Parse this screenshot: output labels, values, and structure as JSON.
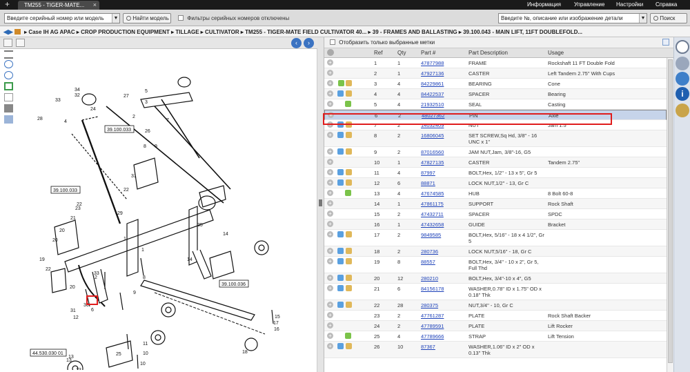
{
  "app": {
    "tab_title": "TM255 - TIGER-MATE...",
    "nav": [
      "Информация",
      "Управление",
      "Настройки",
      "Справка"
    ]
  },
  "toolbar": {
    "serial_select": "Введите серийный номер или модель",
    "find_model_button": "Найти модель",
    "serial_filter_label": "Фильтры серийных номеров отключены",
    "search_placeholder": "Введите №, описание или изображение детали",
    "search_value": "Введите №, описание или изображение детали",
    "search_button": "Поиск"
  },
  "breadcrumb": [
    "Case IH AG APAC",
    "CROP PRODUCTION EQUIPMENT",
    "TILLAGE",
    "CULTIVATOR",
    "TM255 - TIGER-MATE FIELD CULTIVATOR 40...",
    "39 - FRAMES AND BALLASTING",
    "39.100.043 - MAIN LIFT, 11FT DOUBLEFOLD..."
  ],
  "parts_panel": {
    "show_selected_label": "Отобразить только выбранные метки",
    "columns": [
      "Ref",
      "Qty",
      "Part #",
      "Part Description",
      "Usage"
    ],
    "selected_index": 5,
    "rows": [
      {
        "ref": "1",
        "qty": "1",
        "part": "47877988",
        "desc": "FRAME",
        "usage": "Rockshaft 11 FT Double Fold",
        "icons": ""
      },
      {
        "ref": "2",
        "qty": "1",
        "part": "47927136",
        "desc": "CASTER",
        "usage": "Left Tandem 2.75\" With Cups",
        "icons": ""
      },
      {
        "ref": "3",
        "qty": "4",
        "part": "84229861",
        "desc": "BEARING",
        "usage": "Cone",
        "icons": "gb"
      },
      {
        "ref": "4",
        "qty": "4",
        "part": "84422537",
        "desc": "SPACER",
        "usage": "Bearing",
        "icons": "ab"
      },
      {
        "ref": "5",
        "qty": "4",
        "part": "21932510",
        "desc": "SEAL",
        "usage": "Casting",
        "icons": "g"
      },
      {
        "ref": "6",
        "qty": "2",
        "part": "48027362",
        "desc": "PIN",
        "usage": "Axle",
        "icons": ""
      },
      {
        "ref": "7",
        "qty": "2",
        "part": "14032409",
        "desc": "NUT",
        "usage": "Jam 1.5\"",
        "icons": "ab"
      },
      {
        "ref": "8",
        "qty": "2",
        "part": "16806045",
        "desc": "SET SCREW,Sq Hd, 3/8\" - 16 UNC x 1\"",
        "usage": "",
        "icons": "ab"
      },
      {
        "ref": "9",
        "qty": "2",
        "part": "87016560",
        "desc": "JAM NUT,Jam, 3/8\"-16, G5",
        "usage": "",
        "icons": "ab"
      },
      {
        "ref": "10",
        "qty": "1",
        "part": "47827135",
        "desc": "CASTER",
        "usage": "Tandem 2.75\"",
        "icons": ""
      },
      {
        "ref": "11",
        "qty": "4",
        "part": "87997",
        "desc": "BOLT,Hex, 1/2\" - 13 x 5\", Gr 5",
        "usage": "",
        "icons": "ab"
      },
      {
        "ref": "12",
        "qty": "6",
        "part": "88871",
        "desc": "LOCK NUT,1/2\" - 13, Gr C",
        "usage": "",
        "icons": "ab"
      },
      {
        "ref": "13",
        "qty": "4",
        "part": "47674585",
        "desc": "HUB",
        "usage": "8 Bolt 60-8",
        "icons": "g"
      },
      {
        "ref": "14",
        "qty": "1",
        "part": "47861175",
        "desc": "SUPPORT",
        "usage": "Rock Shaft",
        "icons": ""
      },
      {
        "ref": "15",
        "qty": "2",
        "part": "47432711",
        "desc": "SPACER",
        "usage": "SPDC",
        "icons": ""
      },
      {
        "ref": "16",
        "qty": "1",
        "part": "47432658",
        "desc": "GUIDE",
        "usage": "Bracket",
        "icons": ""
      },
      {
        "ref": "17",
        "qty": "2",
        "part": "9849585",
        "desc": "BOLT,Hex, 5/16\" - 18 x 4 1/2\", Gr 5",
        "usage": "",
        "icons": "ab"
      },
      {
        "ref": "18",
        "qty": "2",
        "part": "280736",
        "desc": "LOCK NUT,5/16\" - 18, Gr C",
        "usage": "",
        "icons": "ab"
      },
      {
        "ref": "19",
        "qty": "8",
        "part": "88557",
        "desc": "BOLT,Hex, 3/4\" - 10 x 2\", Gr 5, Full Thd",
        "usage": "",
        "icons": "ab"
      },
      {
        "ref": "20",
        "qty": "12",
        "part": "280210",
        "desc": "BOLT,Hex, 3/4\"-10 x 4\", G5",
        "usage": "",
        "icons": "ab"
      },
      {
        "ref": "21",
        "qty": "6",
        "part": "84156178",
        "desc": "WASHER,0.78\" ID x 1.75\" OD x 0.18\" Thk",
        "usage": "",
        "icons": "ab"
      },
      {
        "ref": "22",
        "qty": "28",
        "part": "280375",
        "desc": "NUT,3/4\" - 10, Gr C",
        "usage": "",
        "icons": "ab"
      },
      {
        "ref": "23",
        "qty": "2",
        "part": "47761287",
        "desc": "PLATE",
        "usage": "Rock Shaft Backer",
        "icons": ""
      },
      {
        "ref": "24",
        "qty": "2",
        "part": "47789591",
        "desc": "PLATE",
        "usage": "Lift Rocker",
        "icons": ""
      },
      {
        "ref": "25",
        "qty": "4",
        "part": "47789666",
        "desc": "STRAP",
        "usage": "Lift Tension",
        "icons": "g"
      },
      {
        "ref": "26",
        "qty": "10",
        "part": "87367",
        "desc": "WASHER,1.06\" ID x 2\" OD x 0.13\" Thk",
        "usage": "",
        "icons": "ab"
      }
    ]
  },
  "diagram": {
    "callouts": [
      "39.100.033",
      "39.100.033",
      "39.100.036",
      "44.530.030 01"
    ],
    "numbers": [
      "27",
      "34",
      "32",
      "24",
      "28",
      "4",
      "5",
      "3",
      "2",
      "33",
      "7",
      "31",
      "9",
      "8",
      "26",
      "1",
      "22",
      "29",
      "35",
      "14",
      "22",
      "23",
      "21",
      "20",
      "20",
      "19",
      "22",
      "33",
      "20",
      "1",
      "8",
      "9",
      "30",
      "12",
      "31",
      "6",
      "17",
      "15",
      "16",
      "10",
      "11",
      "13",
      "12",
      "13",
      "25",
      "18",
      "10",
      "13",
      "2",
      "14"
    ]
  },
  "icons": [
    "prev-icon",
    "next-icon",
    "zoom-in-icon",
    "zoom-out-icon",
    "fit-icon",
    "print-icon",
    "email-icon",
    "search-icon",
    "globe-icon",
    "info-icon",
    "people-icon"
  ]
}
